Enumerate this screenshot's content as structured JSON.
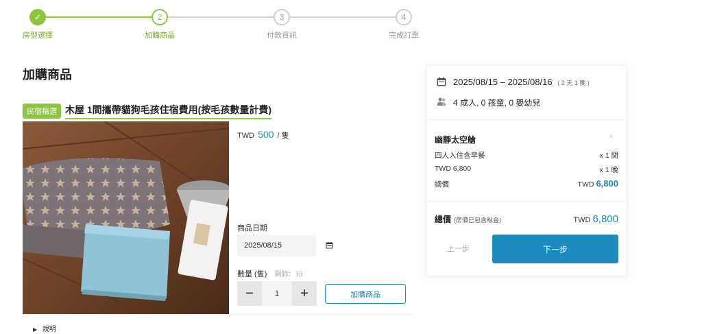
{
  "stepper": {
    "steps": [
      {
        "number": "✓",
        "label": "房型選擇"
      },
      {
        "number": "2",
        "label": "加購商品"
      },
      {
        "number": "3",
        "label": "付款資訊"
      },
      {
        "number": "4",
        "label": "完成訂單"
      }
    ]
  },
  "page": {
    "title": "加購商品"
  },
  "product": {
    "badge": "民宿精選",
    "name": "木屋 1間攜帶貓狗毛孩住宿費用(按毛孩數量計費)",
    "currency": "TWD",
    "price": "500",
    "unit": "/ 隻",
    "date_label": "商品日期",
    "date_value": "2025/08/15",
    "qty_label": "數量 (隻)",
    "remaining": "剩餘：15",
    "qty_value": "1",
    "minus": "−",
    "plus": "+",
    "add_button": "加購商品",
    "description": "說明"
  },
  "summary": {
    "date_range": "2025/08/15 – 2025/08/16",
    "nights": "( 2 天 1 晚 )",
    "guests": "4 成人, 0 孩童, 0 嬰幼兒",
    "room_name": "幽靜太空艙",
    "close": "×",
    "plan": "四人入住含早餐",
    "plan_qty": "x 1 間",
    "rate": "TWD 6,800",
    "rate_qty": "x 1 晚",
    "subtotal_label": "總價",
    "subtotal_currency": "TWD",
    "subtotal_amount": "6,800",
    "total_label": "總價",
    "total_note": "(房價已包含稅金)",
    "total_currency": "TWD",
    "total_amount": "6,800",
    "prev_button": "上一步",
    "next_button": "下一步"
  },
  "colors": {
    "accent_green": "#8cc63f",
    "accent_blue": "#1b8bc0"
  }
}
